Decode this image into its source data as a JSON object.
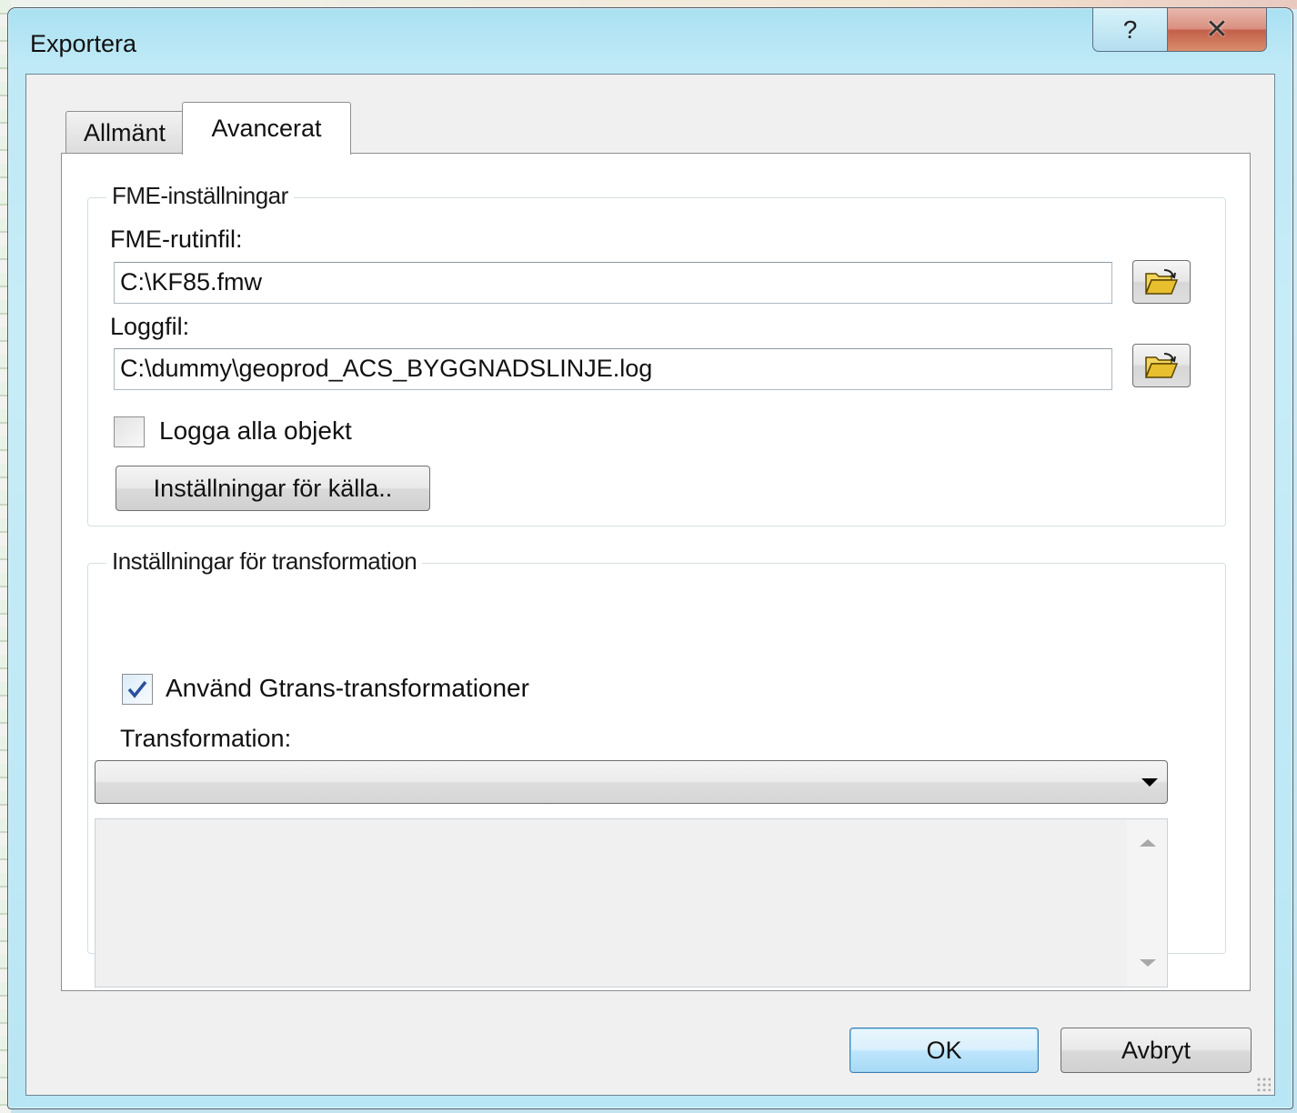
{
  "window": {
    "title": "Exportera",
    "help_glyph": "?",
    "close_glyph": "✕"
  },
  "tabs": [
    {
      "label": "Allmänt",
      "selected": false
    },
    {
      "label": "Avancerat",
      "selected": true
    }
  ],
  "fme_group": {
    "legend": "FME-inställningar",
    "workspace_label": "FME-rutinfil:",
    "workspace_value": "C:\\KF85.fmw",
    "log_label": "Loggfil:",
    "log_value": "C:\\dummy\\geoprod_ACS_BYGGNADSLINJE.log",
    "log_all_label": "Logga alla objekt",
    "log_all_checked": false,
    "source_settings_button": "Inställningar för källa.."
  },
  "transform_group": {
    "legend": "Inställningar för transformation",
    "use_gtrans_label": "Använd Gtrans-transformationer",
    "use_gtrans_checked": true,
    "transformation_label": "Transformation:",
    "transformation_value": ""
  },
  "footer": {
    "ok_label": "OK",
    "cancel_label": "Avbryt"
  },
  "icons": {
    "browse": "folder-open-icon",
    "dropdown": "chevron-down-icon"
  },
  "colors": {
    "title_glass": "#bfe9f6",
    "close_button": "#c3604a",
    "default_button_border": "#3c7fb1",
    "check_mark": "#2a4f9e"
  }
}
